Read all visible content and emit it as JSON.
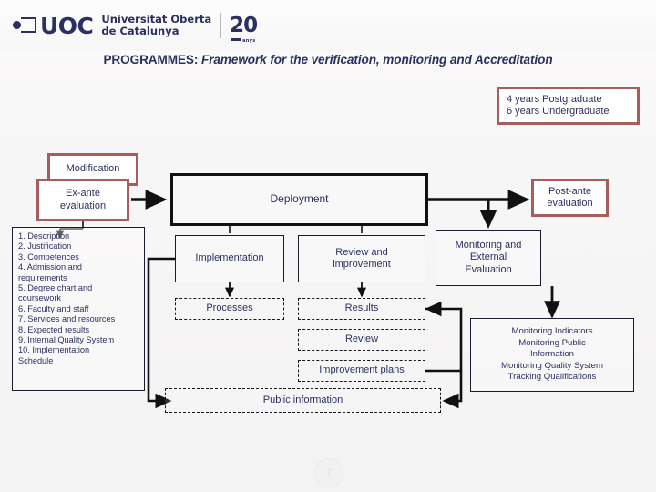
{
  "header": {
    "logo_acronym": "UOC",
    "logo_icon": "uoc-square-dot-mark",
    "university_line1": "Universitat Oberta",
    "university_line2": "de Catalunya",
    "anniversary_number": "20",
    "anniversary_label": "anys",
    "brand_color": "#2b3060"
  },
  "title": {
    "prefix": "PROGRAMMES:",
    "rest": "Framework for the verification, monitoring and Accreditation"
  },
  "colors": {
    "brand_navy": "#2b3060",
    "accent_red": "#a85c5c",
    "line_black": "#111111"
  },
  "diagram": {
    "years_box": {
      "line1": "4 years Postgraduate",
      "line2": "6 years Undergraduate"
    },
    "modification": "Modification",
    "ex_ante": {
      "line1": "Ex-ante",
      "line2": "evaluation"
    },
    "post_ante": {
      "line1": "Post-ante",
      "line2": "evaluation"
    },
    "deployment": "Deployment",
    "implementation": "Implementation",
    "review_and_improvement": {
      "line1": "Review and",
      "line2": "improvement"
    },
    "monitoring_external": {
      "line1": "Monitoring and",
      "line2": "External",
      "line3": "Evaluation"
    },
    "processes": "Processes",
    "results": "Results",
    "review": "Review",
    "improvement_plans": "Improvement plans",
    "public_information": "Public information",
    "monitoring_indicators": {
      "line1": "Monitoring Indicators",
      "line2": "Monitoring Public",
      "line3": "Information",
      "line4": "Monitoring Quality System",
      "line5": "Tracking Qualifications"
    },
    "criteria_list": [
      "1. Description",
      "2. Justification",
      "3. Competences",
      "4. Admission and",
      "requirements",
      "5. Degree chart and",
      "coursework",
      "6. Faculty and staff",
      "7. Services and resources",
      "8. Expected results",
      "9. Internal Quality System",
      "10. Implementation",
      "Schedule"
    ]
  },
  "footer": {
    "page_number": "7"
  }
}
